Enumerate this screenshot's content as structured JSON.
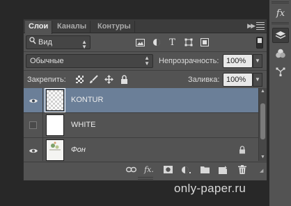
{
  "tabs": [
    {
      "label": "Слои",
      "active": true
    },
    {
      "label": "Каналы",
      "active": false
    },
    {
      "label": "Контуры",
      "active": false
    }
  ],
  "tab_overflow_icon": "double-chevron-right-icon",
  "filter": {
    "search_icon": "search-icon",
    "kind_label": "Вид"
  },
  "filter_icons": [
    "image-filter-icon",
    "adjustment-filter-icon",
    "type-filter-icon",
    "shape-filter-icon",
    "smart-object-filter-icon"
  ],
  "blend_mode": "Обычные",
  "opacity": {
    "label": "Непрозрачность:",
    "value": "100%"
  },
  "lock": {
    "label": "Закрепить:"
  },
  "fill": {
    "label": "Заливка:",
    "value": "100%"
  },
  "layers": [
    {
      "name": "KONTUR",
      "visible": true,
      "selected": true,
      "thumbnail": "transparent"
    },
    {
      "name": "WHITE",
      "visible": false,
      "selected": false,
      "thumbnail": "white"
    },
    {
      "name": "Фон",
      "visible": true,
      "selected": false,
      "thumbnail": "image",
      "locked": true
    }
  ],
  "bottom_icons": [
    "link-icon",
    "fx-icon",
    "mask-icon",
    "adjustment-icon",
    "folder-icon",
    "new-layer-icon",
    "trash-icon"
  ],
  "dock": {
    "fx_label": "fx"
  },
  "watermark": "only-paper.ru",
  "colors": {
    "panel_bg": "#535353",
    "selected_row": "#6b7f98",
    "app_bg": "#282828"
  }
}
